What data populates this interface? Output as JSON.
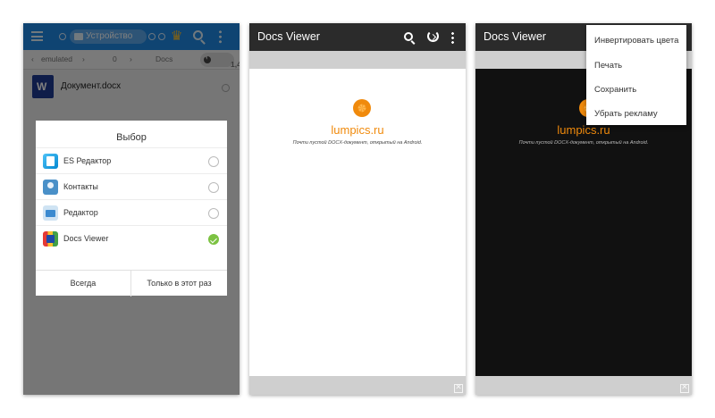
{
  "es_app": {
    "location_chip": "Устройство",
    "path": [
      "emulated",
      "0",
      "Docs"
    ],
    "usage": "1,4%",
    "file_name": "Документ.docx"
  },
  "chooser": {
    "title": "Выбор",
    "options": [
      {
        "label": "ES Редактор",
        "selected": false,
        "icon": "es-editor-icon"
      },
      {
        "label": "Контакты",
        "selected": false,
        "icon": "contacts-icon"
      },
      {
        "label": "Редактор",
        "selected": false,
        "icon": "editor-icon"
      },
      {
        "label": "Docs Viewer",
        "selected": true,
        "icon": "docs-viewer-icon"
      }
    ],
    "always_label": "Всегда",
    "once_label": "Только в этот раз",
    "accent_color": "#7cc242"
  },
  "viewer": {
    "app_title": "Docs Viewer",
    "site_name": "lumpics.ru",
    "doc_text": "Почти пустой DOCX-документ, открытый на Android.",
    "brand_color": "#f08a0c"
  },
  "menu": {
    "items": [
      "Инвертировать цвета",
      "Печать",
      "Сохранить",
      "Убрать рекламу"
    ]
  },
  "colors": {
    "es_header": "#1e88e5",
    "viewer_header": "#2b2b2b",
    "inverted_page": "#111111"
  }
}
